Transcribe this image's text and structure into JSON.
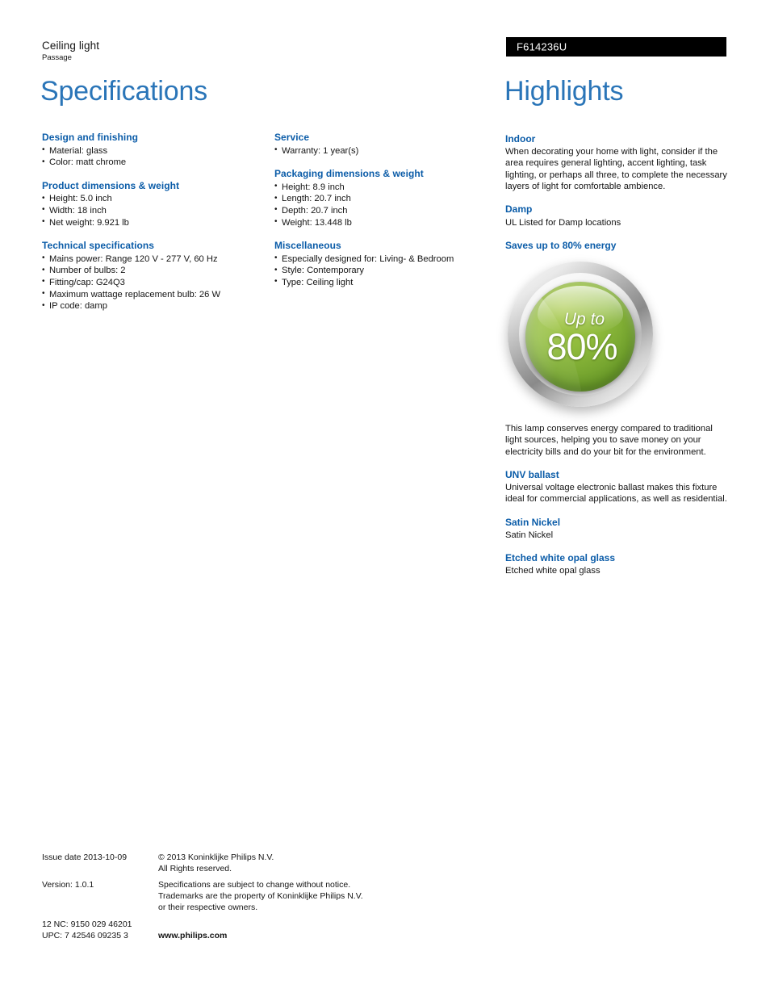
{
  "header": {
    "product_type": "Ceiling light",
    "product_series": "Passage",
    "model_number": "F614236U"
  },
  "titles": {
    "specifications": "Specifications",
    "highlights": "Highlights"
  },
  "specs_column_a": [
    {
      "heading": "Design and finishing",
      "items": [
        "Material: glass",
        "Color: matt chrome"
      ]
    },
    {
      "heading": "Product dimensions & weight",
      "items": [
        "Height: 5.0 inch",
        "Width: 18 inch",
        "Net weight: 9.921 lb"
      ]
    },
    {
      "heading": "Technical specifications",
      "items": [
        "Mains power: Range 120 V - 277 V, 60 Hz",
        "Number of bulbs: 2",
        "Fitting/cap: G24Q3",
        "Maximum wattage replacement bulb: 26 W",
        "IP code: damp"
      ]
    }
  ],
  "specs_column_b": [
    {
      "heading": "Service",
      "items": [
        "Warranty: 1 year(s)"
      ]
    },
    {
      "heading": "Packaging dimensions & weight",
      "items": [
        "Height: 8.9 inch",
        "Length: 20.7 inch",
        "Depth: 20.7 inch",
        "Weight: 13.448 lb"
      ]
    },
    {
      "heading": "Miscellaneous",
      "items": [
        "Especially designed for: Living- & Bedroom",
        "Style: Contemporary",
        "Type: Ceiling light"
      ]
    }
  ],
  "highlights": {
    "indoor": {
      "heading": "Indoor",
      "body": "When decorating your home with light, consider if the area requires general lighting, accent lighting, task lighting, or perhaps all three, to complete the necessary layers of light for comfortable ambience."
    },
    "damp": {
      "heading": "Damp",
      "body": "UL Listed for Damp locations"
    },
    "energy": {
      "heading": "Saves up to 80% energy",
      "badge_upto": "Up to",
      "badge_percent": "80%",
      "body": "This lamp conserves energy compared to traditional light sources, helping you to save money on your electricity bills and do your bit for the environment."
    },
    "ballast": {
      "heading": "UNV ballast",
      "body": "Universal voltage electronic ballast makes this fixture ideal for commercial applications, as well as residential."
    },
    "satin_nickel": {
      "heading": "Satin Nickel",
      "body": "Satin Nickel"
    },
    "opal_glass": {
      "heading": "Etched white opal glass",
      "body": "Etched white opal glass"
    }
  },
  "footer": {
    "issue_date": "Issue date 2013-10-09",
    "version": "Version: 1.0.1",
    "nc_code": "12 NC: 9150 029 46201",
    "upc_code": "UPC: 7 42546 09235 3",
    "copyright_line1": "© 2013 Koninklijke Philips N.V.",
    "copyright_line2": "All Rights reserved.",
    "disclaimer_line1": "Specifications are subject to change without notice.",
    "disclaimer_line2": "Trademarks are the property of Koninklijke Philips N.V.",
    "disclaimer_line3": "or their respective owners.",
    "website": "www.philips.com"
  },
  "colors": {
    "title_blue": "#2a75b8",
    "heading_blue": "#0b5ca8",
    "model_bar_bg": "#000000",
    "badge_green": "#8fbb3c"
  }
}
